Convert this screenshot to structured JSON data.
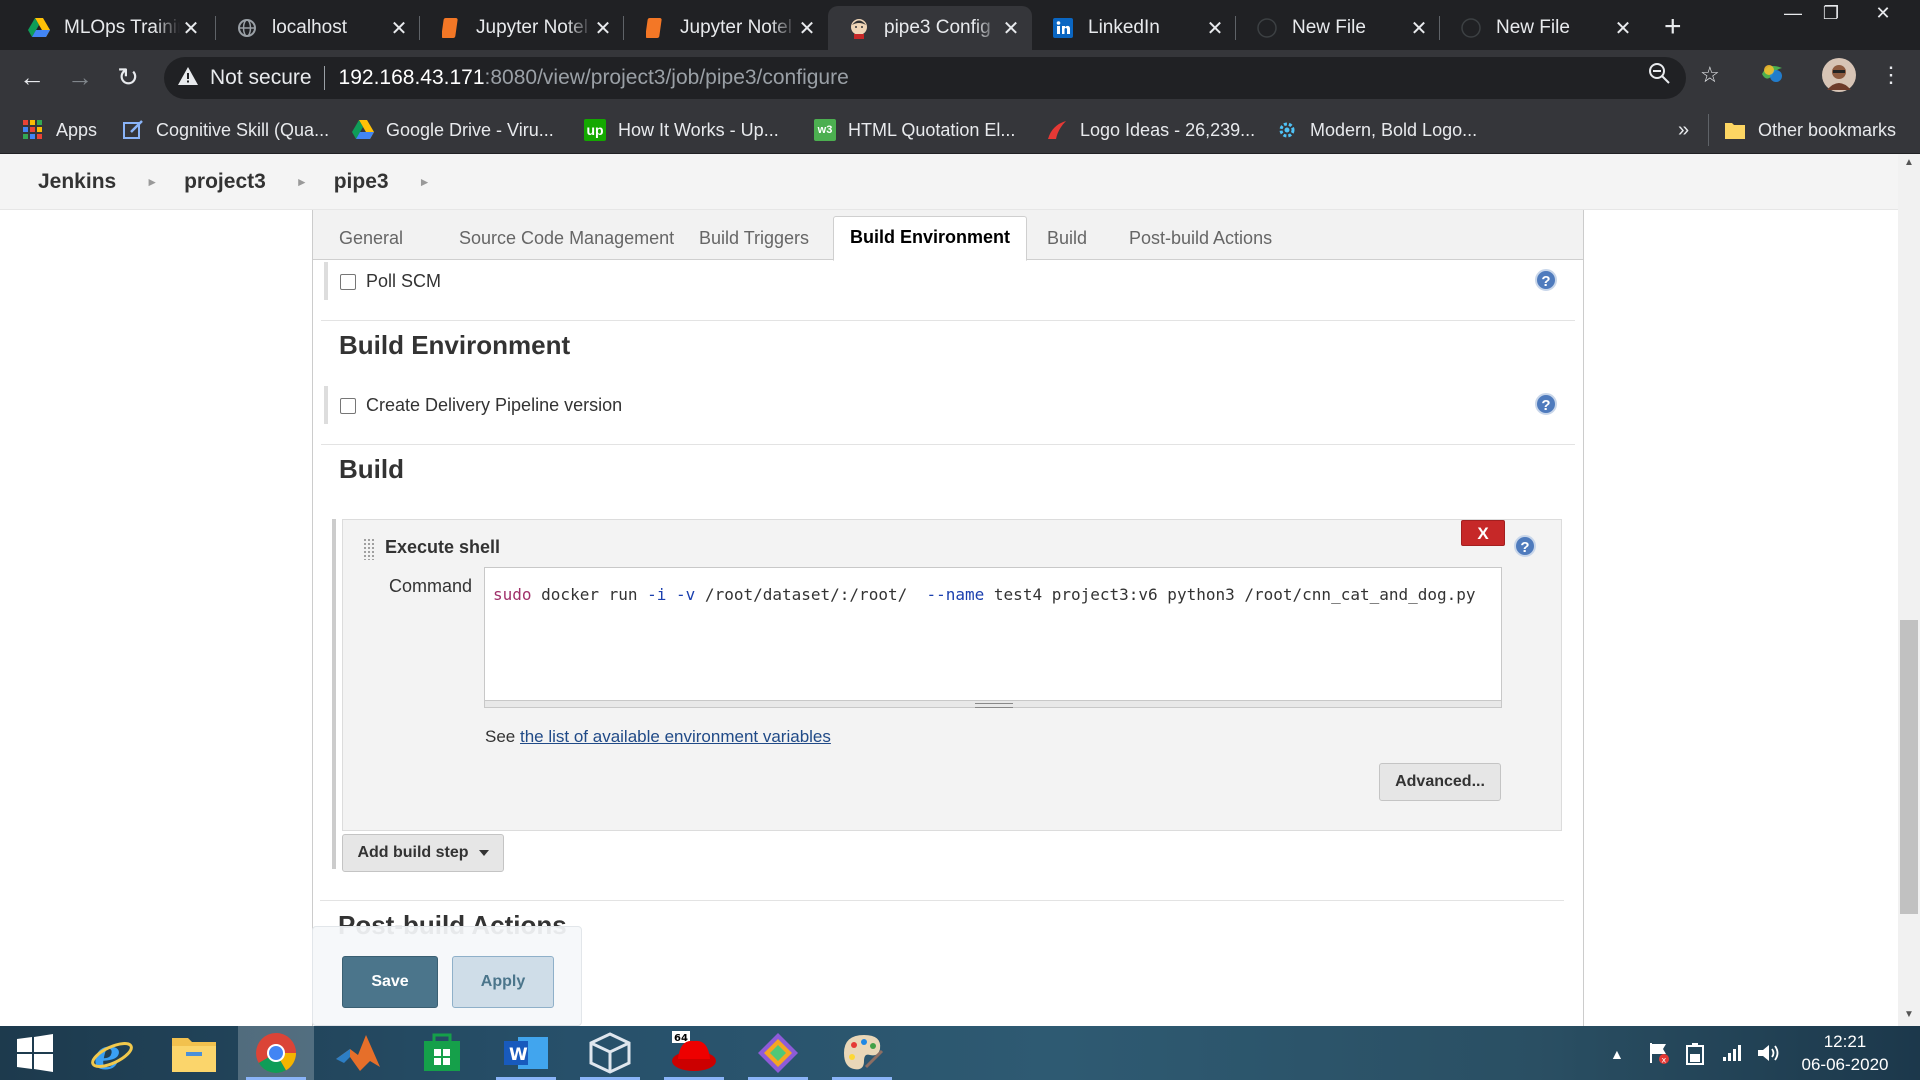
{
  "browser": {
    "tabs": [
      {
        "title": "MLOps Trainin",
        "icon": "google-drive-icon"
      },
      {
        "title": "localhost",
        "icon": "globe-icon"
      },
      {
        "title": "Jupyter Notel",
        "icon": "jupyter-icon"
      },
      {
        "title": "Jupyter Notel",
        "icon": "jupyter-icon"
      },
      {
        "title": "pipe3 Config",
        "icon": "jenkins-icon",
        "active": true
      },
      {
        "title": "LinkedIn",
        "icon": "linkedin-icon"
      },
      {
        "title": "New File",
        "icon": "github-icon"
      },
      {
        "title": "New File",
        "icon": "github-icon"
      }
    ],
    "close_glyph": "✕",
    "new_tab_glyph": "+",
    "address": {
      "security_label": "Not secure",
      "host": "192.168.43.171",
      "path": ":8080/view/project3/job/pipe3/configure"
    },
    "bookmarks": [
      {
        "label": "Apps",
        "icon": "apps-grid-icon"
      },
      {
        "label": "Cognitive Skill (Qua...",
        "icon": "edit-icon"
      },
      {
        "label": "Google Drive - Viru...",
        "icon": "google-drive-icon"
      },
      {
        "label": "How It Works - Up...",
        "icon": "upwork-icon"
      },
      {
        "label": "HTML Quotation El...",
        "icon": "w3schools-icon"
      },
      {
        "label": "Logo Ideas - 26,239...",
        "icon": "logo-ideas-icon"
      },
      {
        "label": "Modern, Bold Logo...",
        "icon": "gear-logo-icon"
      }
    ],
    "bookmarks_more": "»",
    "other_bookmarks": "Other bookmarks"
  },
  "jenkins": {
    "breadcrumb": [
      "Jenkins",
      "project3",
      "pipe3"
    ],
    "config_tabs": [
      "General",
      "Source Code Management",
      "Build Triggers",
      "Build Environment",
      "Build",
      "Post-build Actions"
    ],
    "active_tab": "Build Environment",
    "poll_scm_label": "Poll SCM",
    "build_env_title": "Build Environment",
    "delivery_pipeline_label": "Create Delivery Pipeline version",
    "build_title": "Build",
    "execute_shell": {
      "title": "Execute shell",
      "delete_label": "X",
      "command_label": "Command",
      "command_tokens": [
        {
          "text": "sudo",
          "style": "kw"
        },
        {
          "text": " docker run ",
          "style": ""
        },
        {
          "text": "-i",
          "style": "fl"
        },
        {
          "text": " ",
          "style": ""
        },
        {
          "text": "-v",
          "style": "fl"
        },
        {
          "text": " /root/dataset/:/root/  ",
          "style": ""
        },
        {
          "text": "--name",
          "style": "fl"
        },
        {
          "text": " test4 project3:v6 python3 /root/cnn_cat_and_dog.py",
          "style": ""
        }
      ],
      "see_prefix": "See ",
      "env_vars_link": "the list of available environment variables",
      "advanced_label": "Advanced..."
    },
    "add_build_step_label": "Add build step",
    "post_build_title": "Post-build Actions",
    "save_label": "Save",
    "apply_label": "Apply",
    "help_glyph": "?"
  },
  "taskbar": {
    "time": "12:21",
    "date": "06-06-2020",
    "apps": [
      "start-icon",
      "internet-explorer-icon",
      "file-explorer-icon",
      "chrome-icon",
      "matlab-icon",
      "microsoft-store-icon",
      "word-icon",
      "virtualbox-icon",
      "redhat-icon",
      "git-icon",
      "paint-icon"
    ]
  },
  "colors": {
    "chrome_dark": "#202124",
    "chrome_toolbar": "#35363a",
    "jenkins_save": "#4b758b",
    "delete_red": "#c62828",
    "help_blue": "#4f7bbd",
    "link": "#204a87"
  }
}
